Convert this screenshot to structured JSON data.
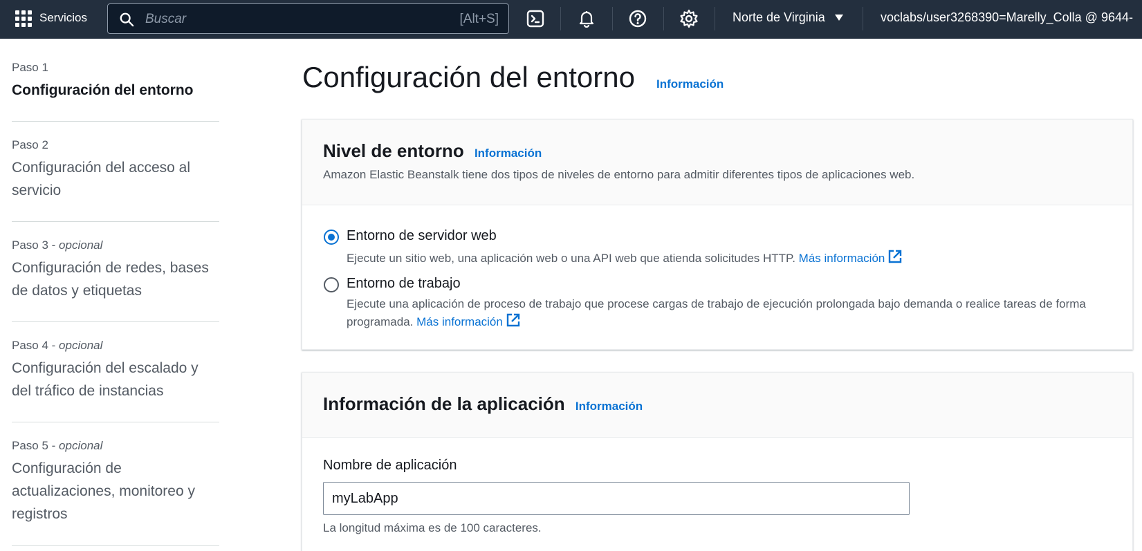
{
  "topnav": {
    "services_label": "Servicios",
    "search_placeholder": "Buscar",
    "search_shortcut": "[Alt+S]",
    "region": "Norte de Virginia",
    "account": "voclabs/user3268390=Marelly_Colla @ 9644-"
  },
  "steps": [
    {
      "number": "Paso 1",
      "optional": "",
      "title": "Configuración del entorno"
    },
    {
      "number": "Paso 2",
      "optional": "",
      "title": "Configuración del acceso al servicio"
    },
    {
      "number": "Paso 3",
      "optional": "opcional",
      "title": "Configuración de redes, bases de datos y etiquetas"
    },
    {
      "number": "Paso 4",
      "optional": "opcional",
      "title": "Configuración del escalado y del tráfico de instancias"
    },
    {
      "number": "Paso 5",
      "optional": "opcional",
      "title": "Configuración de actualizaciones, monitoreo y registros"
    }
  ],
  "main": {
    "title": "Configuración del entorno",
    "info": "Información"
  },
  "tier_card": {
    "title": "Nivel de entorno",
    "info": "Información",
    "description": "Amazon Elastic Beanstalk tiene dos tipos de niveles de entorno para admitir diferentes tipos de aplicaciones web.",
    "options": [
      {
        "label": "Entorno de servidor web",
        "description": "Ejecute un sitio web, una aplicación web o una API web que atienda solicitudes HTTP.",
        "link": "Más información",
        "selected": true
      },
      {
        "label": "Entorno de trabajo",
        "description": "Ejecute una aplicación de proceso de trabajo que procese cargas de trabajo de ejecución prolongada bajo demanda o realice tareas de forma programada.",
        "link": "Más información",
        "selected": false
      }
    ]
  },
  "app_card": {
    "title": "Información de la aplicación",
    "info": "Información",
    "name_label": "Nombre de aplicación",
    "name_value": "myLabApp",
    "constraint": "La longitud máxima es de 100 caracteres."
  },
  "colors": {
    "nav_bg": "#232f3e",
    "link": "#0972d3"
  }
}
